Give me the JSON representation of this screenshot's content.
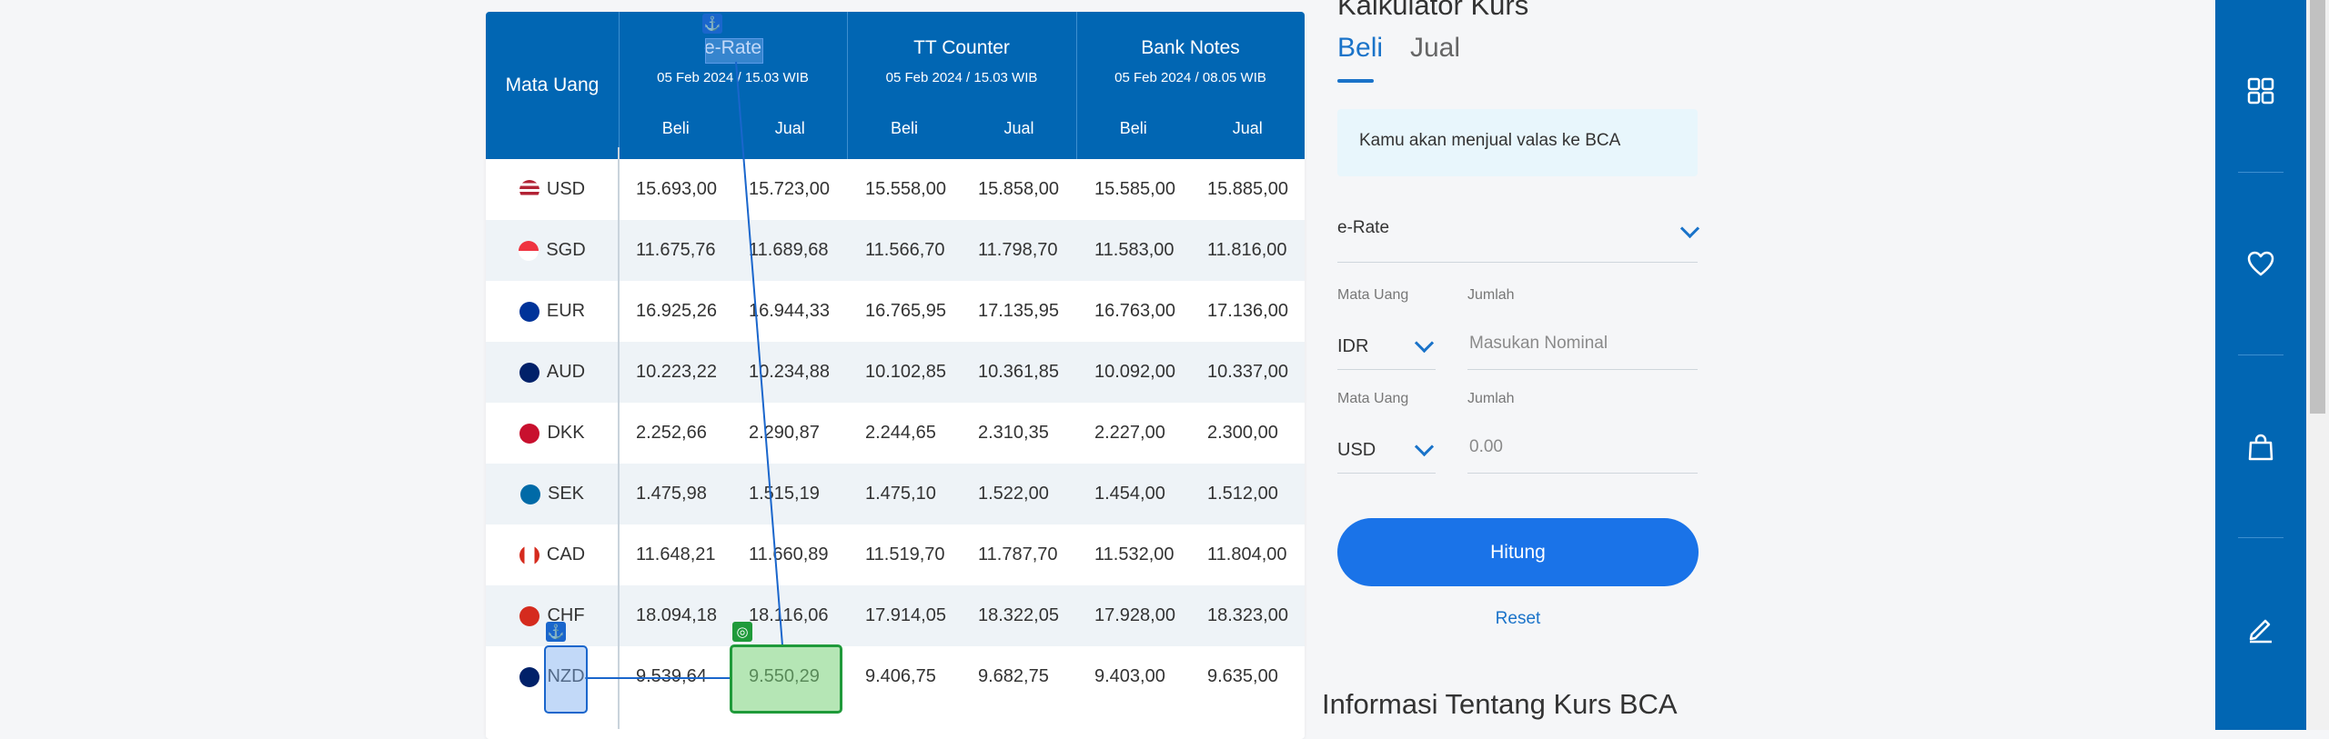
{
  "table": {
    "header": {
      "currency_label": "Mata Uang",
      "groups": [
        {
          "title": "e-Rate",
          "date": "05 Feb 2024 / 15.03 WIB",
          "buy": "Beli",
          "sell": "Jual"
        },
        {
          "title": "TT Counter",
          "date": "05 Feb 2024 / 15.03 WIB",
          "buy": "Beli",
          "sell": "Jual"
        },
        {
          "title": "Bank Notes",
          "date": "05 Feb 2024 / 08.05 WIB",
          "buy": "Beli",
          "sell": "Jual"
        }
      ]
    },
    "rows": [
      {
        "code": "USD",
        "flag": "us-flag-icon",
        "values": [
          "15.693,00",
          "15.723,00",
          "15.558,00",
          "15.858,00",
          "15.585,00",
          "15.885,00"
        ]
      },
      {
        "code": "SGD",
        "flag": "sg-flag-icon",
        "values": [
          "11.675,76",
          "11.689,68",
          "11.566,70",
          "11.798,70",
          "11.583,00",
          "11.816,00"
        ]
      },
      {
        "code": "EUR",
        "flag": "eu-flag-icon",
        "values": [
          "16.925,26",
          "16.944,33",
          "16.765,95",
          "17.135,95",
          "16.763,00",
          "17.136,00"
        ]
      },
      {
        "code": "AUD",
        "flag": "au-flag-icon",
        "values": [
          "10.223,22",
          "10.234,88",
          "10.102,85",
          "10.361,85",
          "10.092,00",
          "10.337,00"
        ]
      },
      {
        "code": "DKK",
        "flag": "dk-flag-icon",
        "values": [
          "2.252,66",
          "2.290,87",
          "2.244,65",
          "2.310,35",
          "2.227,00",
          "2.300,00"
        ]
      },
      {
        "code": "SEK",
        "flag": "se-flag-icon",
        "values": [
          "1.475,98",
          "1.515,19",
          "1.475,10",
          "1.522,00",
          "1.454,00",
          "1.512,00"
        ]
      },
      {
        "code": "CAD",
        "flag": "ca-flag-icon",
        "values": [
          "11.648,21",
          "11.660,89",
          "11.519,70",
          "11.787,70",
          "11.532,00",
          "11.804,00"
        ]
      },
      {
        "code": "CHF",
        "flag": "ch-flag-icon",
        "values": [
          "18.094,18",
          "18.116,06",
          "17.914,05",
          "18.322,05",
          "17.928,00",
          "18.323,00"
        ]
      },
      {
        "code": "NZD",
        "flag": "nz-flag-icon",
        "values": [
          "9.539,64",
          "9.550,29",
          "9.406,75",
          "9.682,75",
          "9.403,00",
          "9.635,00"
        ]
      }
    ]
  },
  "calculator": {
    "title": "Kalkulator Kurs",
    "tabs": {
      "buy": "Beli",
      "sell": "Jual"
    },
    "info": "Kamu akan menjual valas ke BCA",
    "rate_type": "e-Rate",
    "from": {
      "currency_label": "Mata Uang",
      "currency": "IDR",
      "amount_label": "Jumlah",
      "amount_placeholder": "Masukan Nominal"
    },
    "to": {
      "currency_label": "Mata Uang",
      "currency": "USD",
      "amount_label": "Jumlah",
      "amount_placeholder": "0.00"
    },
    "button": "Hitung",
    "reset": "Reset"
  },
  "info_heading": "Informasi Tentang Kurs BCA",
  "sidebar": {
    "items": [
      "grid-icon",
      "heart-icon",
      "shopping-bag-icon",
      "pencil-icon"
    ]
  },
  "colors": {
    "header_blue": "#0166b3",
    "accent_blue": "#1a73e8",
    "overlay_green": "#1f9a3a"
  }
}
